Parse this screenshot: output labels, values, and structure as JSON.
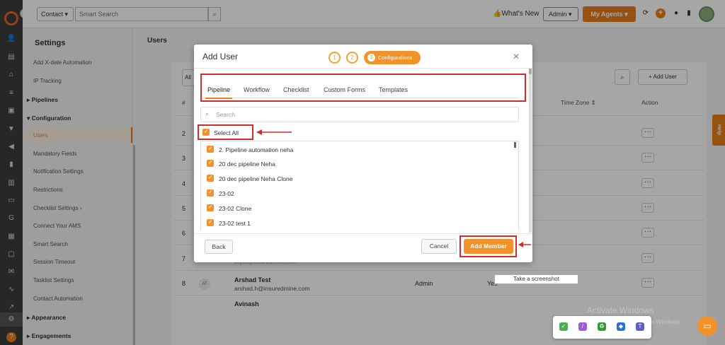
{
  "topbar": {
    "context_select": "Contact",
    "search_placeholder": "Smart Search",
    "whats_new": "What's New",
    "role_select": "Admin",
    "my_agents": "My Agents"
  },
  "sidebar": {
    "title": "Settings",
    "items": [
      {
        "label": "Add X-date Automation"
      },
      {
        "label": "IP Tracking"
      },
      {
        "label": "Pipelines"
      },
      {
        "label": "Configuration"
      },
      {
        "label": "Users"
      },
      {
        "label": "Mandatory Fields"
      },
      {
        "label": "Notification Settings"
      },
      {
        "label": "Restrictions"
      },
      {
        "label": "Checklist Settings"
      },
      {
        "label": "Connect Your AMS"
      },
      {
        "label": "Smart Search"
      },
      {
        "label": "Session Timeout"
      },
      {
        "label": "Tasklist Settings"
      },
      {
        "label": "Contact Automation"
      },
      {
        "label": "Appearance"
      },
      {
        "label": "Engagements"
      }
    ]
  },
  "content": {
    "title": "Users",
    "all_tab": "All",
    "add_user": "Add User",
    "headers": {
      "hash": "#",
      "timezone": "Time Zone",
      "action": "Action"
    },
    "row_numbers": [
      "2",
      "3",
      "4",
      "5",
      "6",
      "7",
      "8"
    ],
    "row7_email": "anjca@insuredmine.com",
    "row8": {
      "avatar": "AT",
      "name": "Arshad Test",
      "email": "arshad.h@insuredmine.com",
      "role": "Admin",
      "status": "Yes"
    },
    "row9_name": "Avinash",
    "help": "Help"
  },
  "modal": {
    "title": "Add User",
    "steps": [
      "1",
      "2",
      "3"
    ],
    "step3_label": "Configurations",
    "tabs": [
      "Pipeline",
      "Workflow",
      "Checklist",
      "Custom Forms",
      "Templates"
    ],
    "search_placeholder": "Search",
    "select_all": "Select All",
    "pipelines": [
      "2. Pipeline automation neha",
      "20 dec pipeline Neha",
      "20 dec pipeline Neha Clone",
      "23-02",
      "23-02 Clone",
      "23-02 test 1"
    ],
    "back": "Back",
    "cancel": "Cancel",
    "add_member": "Add Member"
  },
  "overlay": {
    "tooltip": "Take a screenshot",
    "activate_title": "Activate Windows",
    "activate_sub": "Go to Settings to activate Windows."
  },
  "colors": {
    "accent": "#f1922a",
    "annotation": "#d62b2b",
    "rail": "#3d3d3d"
  }
}
